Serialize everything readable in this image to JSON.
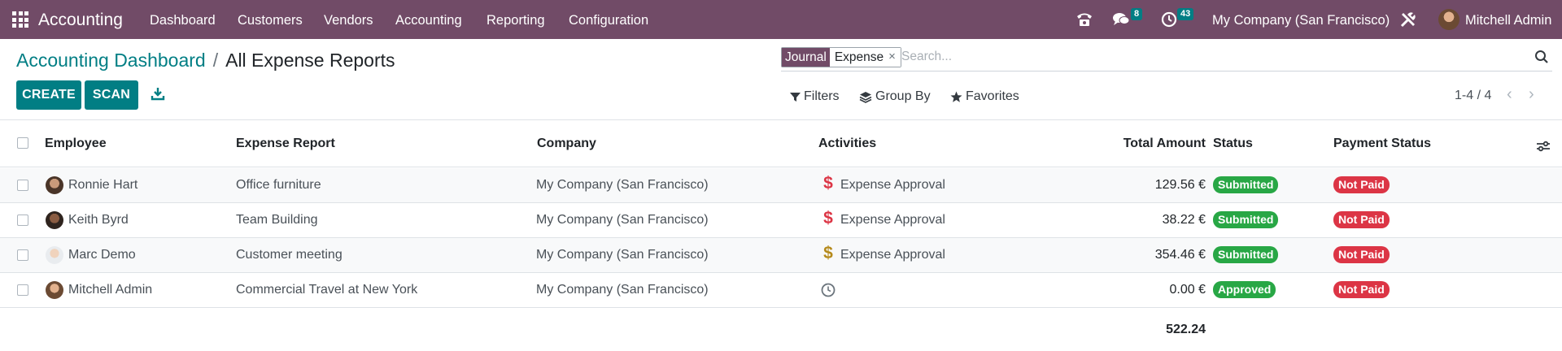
{
  "navbar": {
    "brand": "Accounting",
    "menu": [
      "Dashboard",
      "Customers",
      "Vendors",
      "Accounting",
      "Reporting",
      "Configuration"
    ],
    "chat_count": "8",
    "activity_count": "43",
    "company": "My Company (San Francisco)",
    "user": "Mitchell Admin"
  },
  "breadcrumb": {
    "parent": "Accounting Dashboard",
    "separator": "/",
    "current": "All Expense Reports"
  },
  "toolbar": {
    "create_label": "CREATE",
    "scan_label": "SCAN"
  },
  "search": {
    "facet_label": "Journal",
    "facet_value": "Expense",
    "facet_remove": "×",
    "placeholder": "Search..."
  },
  "filters": {
    "filters_label": "Filters",
    "group_by_label": "Group By",
    "favorites_label": "Favorites"
  },
  "pager": {
    "value": "1-4 / 4",
    "prev": "‹",
    "next": "›"
  },
  "table": {
    "columns": {
      "employee": "Employee",
      "report": "Expense Report",
      "company": "Company",
      "activities": "Activities",
      "total": "Total Amount",
      "status": "Status",
      "payment": "Payment Status"
    },
    "rows": [
      {
        "employee": "Ronnie Hart",
        "report": "Office furniture",
        "company": "My Company (San Francisco)",
        "activity": "Expense Approval",
        "activity_icon": "dollar-icon",
        "activity_color": "#dc3545",
        "amount": "129.56 €",
        "status": "Submitted",
        "status_color": "#28a745",
        "payment": "Not Paid",
        "payment_color": "#dc3545"
      },
      {
        "employee": "Keith Byrd",
        "report": "Team Building",
        "company": "My Company (San Francisco)",
        "activity": "Expense Approval",
        "activity_icon": "dollar-icon",
        "activity_color": "#dc3545",
        "amount": "38.22 €",
        "status": "Submitted",
        "status_color": "#28a745",
        "payment": "Not Paid",
        "payment_color": "#dc3545"
      },
      {
        "employee": "Marc Demo",
        "report": "Customer meeting",
        "company": "My Company (San Francisco)",
        "activity": "Expense Approval",
        "activity_icon": "dollar-icon",
        "activity_color": "#b58a1b",
        "amount": "354.46 €",
        "status": "Submitted",
        "status_color": "#28a745",
        "payment": "Not Paid",
        "payment_color": "#dc3545"
      },
      {
        "employee": "Mitchell Admin",
        "report": "Commercial Travel at New York",
        "company": "My Company (San Francisco)",
        "activity": "",
        "activity_icon": "clock-icon",
        "activity_color": "#6c757d",
        "amount": "0.00 €",
        "status": "Approved",
        "status_color": "#28a745",
        "payment": "Not Paid",
        "payment_color": "#dc3545"
      }
    ],
    "total": "522.24"
  },
  "colors": {
    "brand": "#714b67",
    "primary": "#017e84",
    "success": "#28a745",
    "danger": "#dc3545"
  }
}
